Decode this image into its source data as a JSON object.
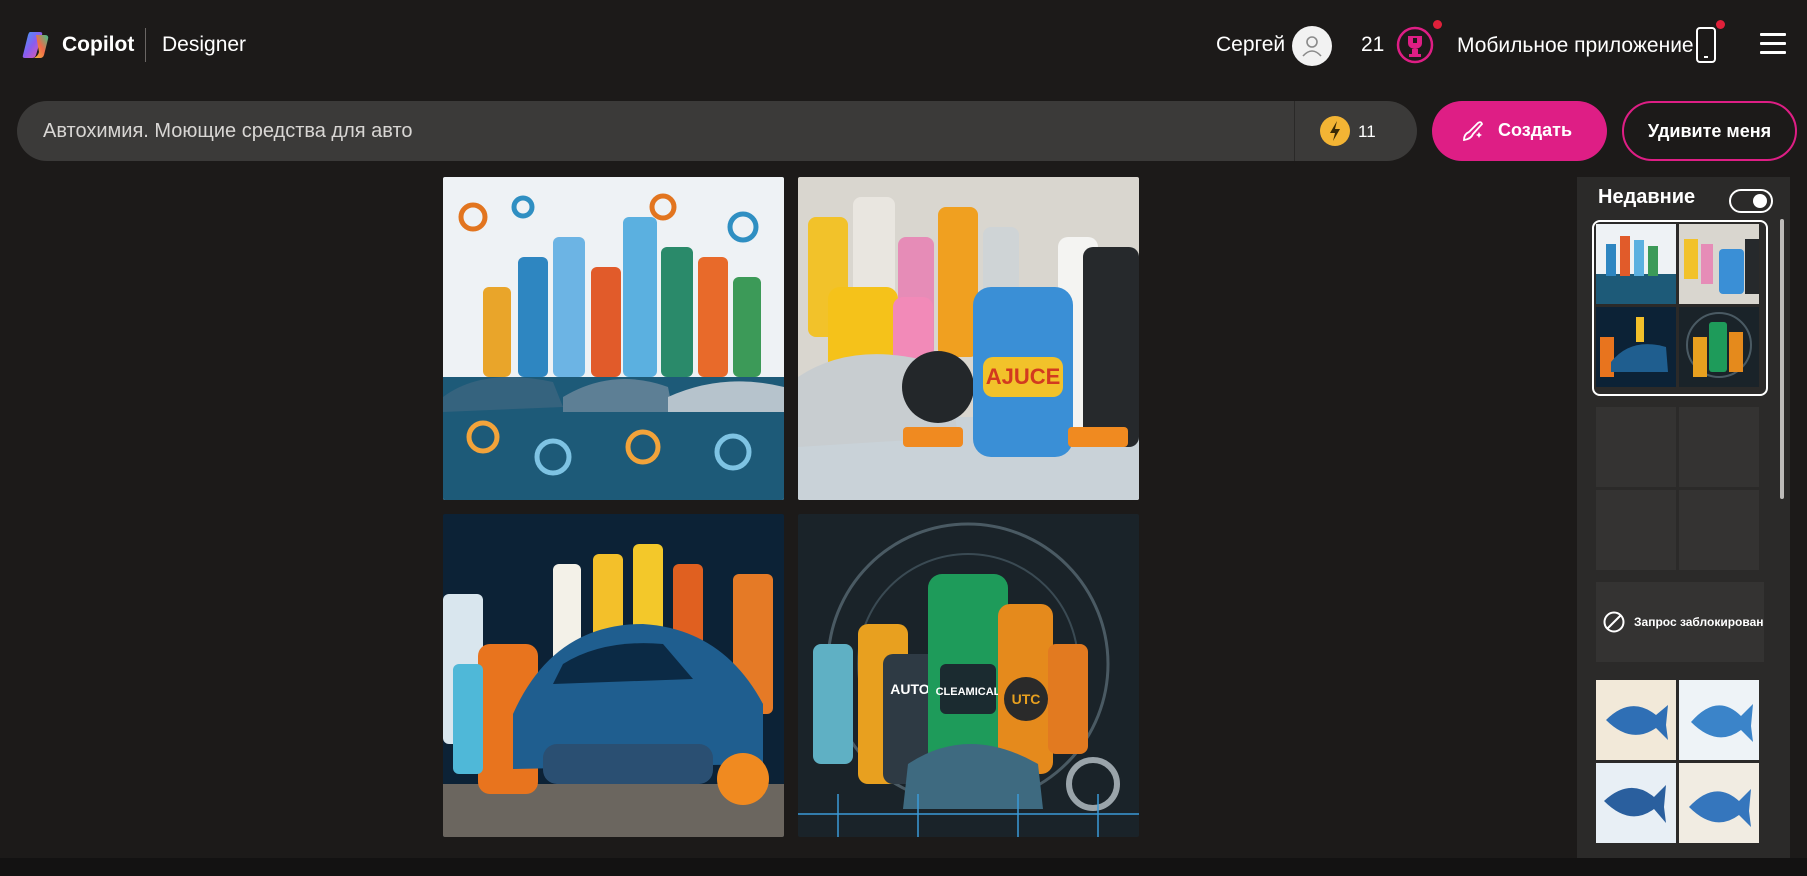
{
  "header": {
    "brand": "Copilot",
    "product": "Designer",
    "user_name": "Сергей",
    "boost_count": "21",
    "mobile_app_label": "Мобильное приложение",
    "icons": [
      "copilot-logo-icon",
      "user-avatar-icon",
      "rewards-icon",
      "phone-icon",
      "hamburger-menu-icon"
    ]
  },
  "search": {
    "prompt_value": "Автохимия. Моющие средства для авто",
    "boosts_left": "11",
    "create_label": "Создать",
    "surprise_label": "Удивите меня"
  },
  "results": {
    "images": [
      {
        "subject": "cleaning bottles with gears and cars"
      },
      {
        "subject": "detergent bottles and brushes next to car"
      },
      {
        "subject": "blue car with cleaning products and towels"
      },
      {
        "subject": "green bottle with car chemical labels",
        "labels": [
          "AUTO",
          "CLEAMICAL",
          "UTC"
        ]
      }
    ],
    "image_texts": {
      "tile2_label": "AJUCE",
      "tile4_label_a": "AUTO",
      "tile4_label_b": "CLEAMICAL",
      "tile4_label_c": "UTC"
    }
  },
  "recent": {
    "title": "Недавние",
    "toggle_on": true,
    "blocked_text": "Запрос заблокирован"
  },
  "colors": {
    "background": "#1c1a19",
    "accent": "#de1e85",
    "boost": "#f3b434",
    "input_bg": "#3b3a39",
    "panel_bg": "#2b2a29"
  }
}
